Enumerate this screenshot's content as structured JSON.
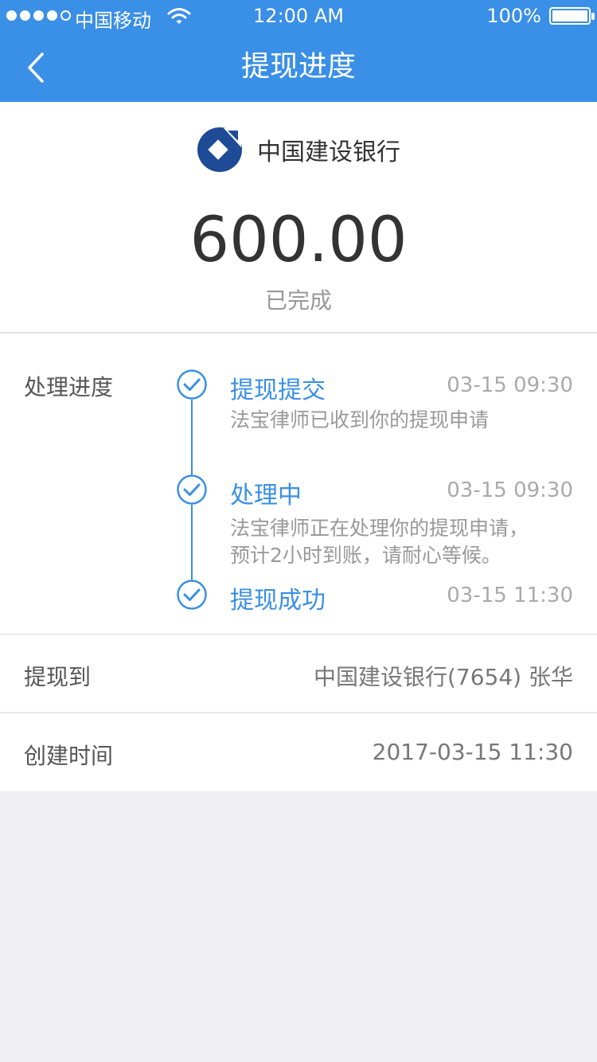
{
  "status_bar": {
    "carrier": "中国移动",
    "time": "12:00 AM",
    "battery": "100%",
    "signal_bars": 4
  },
  "nav": {
    "title": "提现进度",
    "back_icon": "chevron-left-icon"
  },
  "summary": {
    "bank_name": "中国建设银行",
    "bank_logo": "ccb-logo",
    "amount": "600.00",
    "state": "已完成"
  },
  "progress": {
    "label": "处理进度",
    "steps": [
      {
        "title": "提现提交",
        "time": "03-15 09:30",
        "desc": [
          "法宝律师已收到你的提现申请"
        ]
      },
      {
        "title": "处理中",
        "time": "03-15 09:30",
        "desc": [
          "法宝律师正在处理你的提现申请，",
          "预计2小时到账，请耐心等候。"
        ]
      },
      {
        "title": "提现成功",
        "time": "03-15 11:30",
        "desc": []
      }
    ]
  },
  "details": {
    "withdraw_to_label": "提现到",
    "withdraw_to_value": "中国建设银行(7654) 张华",
    "created_label": "创建时间",
    "created_value": "2017-03-15 11:30"
  },
  "colors": {
    "accent": "#3a8fe6",
    "bank_logo": "#1e4a96"
  }
}
